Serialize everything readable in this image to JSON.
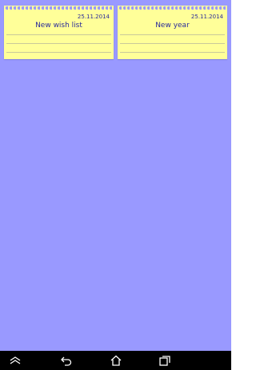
{
  "notes": [
    {
      "date": "25.11.2014",
      "title": "New wish list"
    },
    {
      "date": "25.11.2014",
      "title": "New year"
    }
  ],
  "colors": {
    "background": "#9999ff",
    "note_paper": "#ffff99",
    "note_text": "#2a2a9a",
    "nav_bar": "#000000"
  },
  "navbar": {
    "buttons": [
      "collapse-icon",
      "back-icon",
      "home-icon",
      "recent-apps-icon"
    ]
  }
}
